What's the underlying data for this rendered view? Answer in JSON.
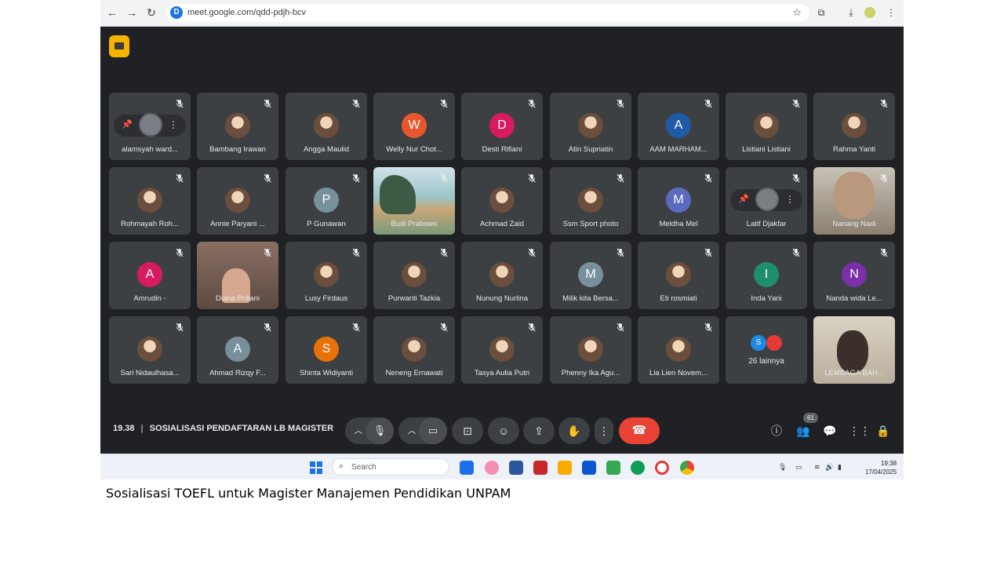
{
  "browser": {
    "url": "meet.google.com/qdd-pdjh-bcv",
    "site_icon_letter": "D"
  },
  "meeting": {
    "time": "19.38",
    "title": "SOSIALISASI PENDAFTARAN LB MAGISTER",
    "participant_count": "61",
    "more_label": "26 lainnya"
  },
  "tiles": [
    {
      "name": "alamsyah ward...",
      "kind": "hover"
    },
    {
      "name": "Bambang Irawan",
      "kind": "photo"
    },
    {
      "name": "Angga Maulid",
      "kind": "photo"
    },
    {
      "name": "Welly Nur Chot...",
      "kind": "letter",
      "letter": "W",
      "color": "#e8562d"
    },
    {
      "name": "Desti Rifiani",
      "kind": "letter",
      "letter": "D",
      "color": "#d81b60"
    },
    {
      "name": "Atin Supriatin",
      "kind": "photo"
    },
    {
      "name": "AAM MARHAM...",
      "kind": "letter",
      "letter": "A",
      "color": "#1e5aa8"
    },
    {
      "name": "Listiani Listiani",
      "kind": "photo"
    },
    {
      "name": "Rahma Yanti",
      "kind": "photo"
    },
    {
      "name": "Rohmayah Roh...",
      "kind": "photo"
    },
    {
      "name": "Annie Paryani ...",
      "kind": "photo"
    },
    {
      "name": "P Gunawan",
      "kind": "letter",
      "letter": "P",
      "color": "#78909c"
    },
    {
      "name": "Budi Prabowo",
      "kind": "video-beach"
    },
    {
      "name": "Achmad Zaid",
      "kind": "photo"
    },
    {
      "name": "Ssm Sport photo",
      "kind": "photo"
    },
    {
      "name": "Meldha Mel",
      "kind": "letter",
      "letter": "M",
      "color": "#5c6bc0"
    },
    {
      "name": "Latif Djakfar",
      "kind": "hover"
    },
    {
      "name": "Nanang Nadi",
      "kind": "video-person-a"
    },
    {
      "name": "Amrudin -",
      "kind": "letter",
      "letter": "A",
      "color": "#d81b60"
    },
    {
      "name": "Diana Priliani",
      "kind": "video-person-b"
    },
    {
      "name": "Lusy Firdaus",
      "kind": "photo"
    },
    {
      "name": "Purwanti Tazkia",
      "kind": "photo"
    },
    {
      "name": "Nunung Nurlina",
      "kind": "photo"
    },
    {
      "name": "Milik kita Bersa...",
      "kind": "letter",
      "letter": "M",
      "color": "#78909c"
    },
    {
      "name": "Eti rosmiati",
      "kind": "photo"
    },
    {
      "name": "Inda Yani",
      "kind": "letter",
      "letter": "I",
      "color": "#1e8e6e"
    },
    {
      "name": "Nanda wida Le...",
      "kind": "letter",
      "letter": "N",
      "color": "#7b2fa8"
    },
    {
      "name": "Sari Nidaulhasa...",
      "kind": "photo"
    },
    {
      "name": "Ahmad Rizqy F...",
      "kind": "letter",
      "letter": "A",
      "color": "#78909c"
    },
    {
      "name": "Shinta Widiyanti",
      "kind": "letter",
      "letter": "S",
      "color": "#e8710a"
    },
    {
      "name": "Neneng Ernawati",
      "kind": "photo"
    },
    {
      "name": "Tasya Aulia Putri",
      "kind": "photo"
    },
    {
      "name": "Phenny Ika Agu...",
      "kind": "photo"
    },
    {
      "name": "Lia Lien Novem...",
      "kind": "photo"
    },
    {
      "name": "26 lainnya",
      "kind": "more"
    },
    {
      "name": "LEMBAGA BAH...",
      "kind": "video-person-c"
    }
  ],
  "taskbar": {
    "search_placeholder": "Search",
    "time": "19:38",
    "date": "17/04/2025"
  },
  "caption": "Sosialisasi TOEFL untuk Magister Manajemen Pendidikan UNPAM",
  "colors": {
    "meet_bg": "#202124",
    "tile_bg": "#3c4043",
    "end_call": "#ea4335",
    "meet_logo": "#f5b400"
  }
}
